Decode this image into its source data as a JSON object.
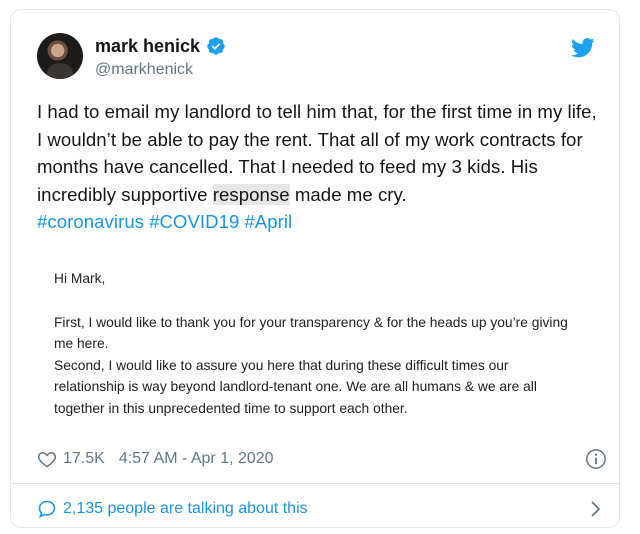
{
  "author": {
    "name": "mark henick",
    "handle": "@markhenick"
  },
  "tweet": {
    "text_before": "I had to email my landlord to tell him that, for the first time in my life, I wouldn’t be able to pay the rent. That all of my work contracts for months have cancelled. That I needed to feed my 3 kids. His incredibly supportive ",
    "text_highlight": "response",
    "text_after": " made me cry.",
    "hashtags": [
      "#coronavirus",
      "#COVID19",
      "#April"
    ]
  },
  "image_letter": {
    "greeting": "Hi Mark,",
    "line1": "First, I would like to thank you for your transparency & for the heads up you’re giving me here.",
    "line2": "Second, I would like to assure you here that during these difficult times our relationship is way beyond landlord-tenant one. We are all humans & we are all together in this unprecedented time to support each other."
  },
  "meta": {
    "likes": "17.5K",
    "timestamp": "4:57 AM - Apr 1, 2020"
  },
  "footer": {
    "talking": "2,135 people are talking about this"
  },
  "colors": {
    "link": "#1b95e0",
    "secondary": "#657786",
    "border": "#e1e8ed"
  },
  "icons": [
    "verified-badge-icon",
    "twitter-bird-icon",
    "heart-icon",
    "info-icon",
    "speech-bubble-icon",
    "chevron-right-icon"
  ]
}
